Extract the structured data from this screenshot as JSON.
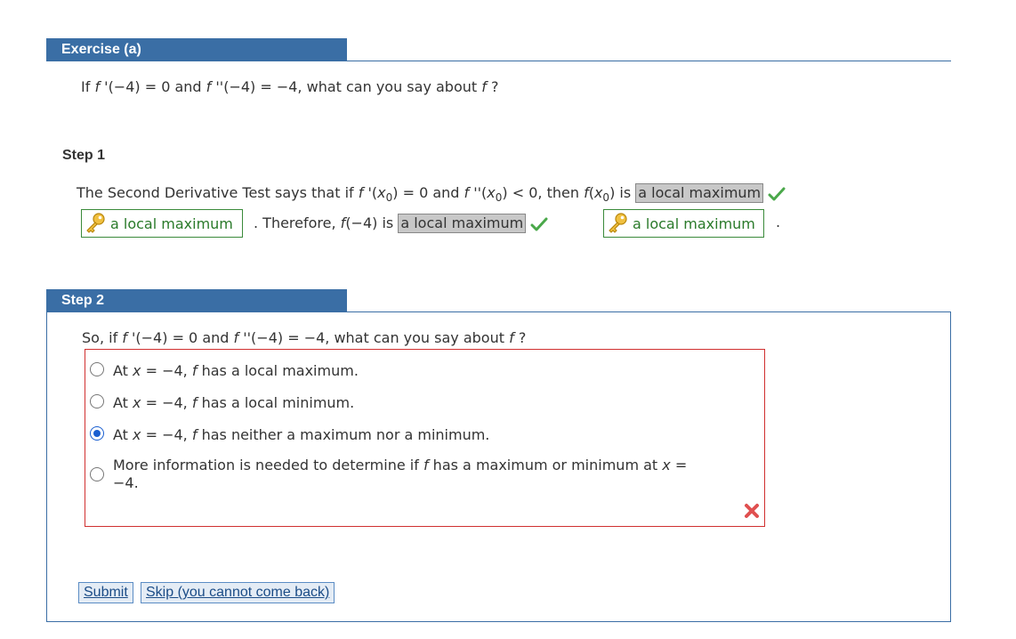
{
  "exercise": {
    "header": "Exercise (a)",
    "question_prefix": "If ",
    "f1": "f",
    "q1": " '(−4) = 0 and ",
    "f2": "f",
    "q2": " ''(−4) = −4,  what can you say about ",
    "f3": "f",
    "q3": " ?"
  },
  "step1": {
    "title": "Step 1",
    "line1_prefix": "The Second Derivative Test says that if ",
    "f_a": "f",
    "line1_mid1": " '(",
    "x0a": "x",
    "sub0a": "0",
    "line1_mid2": ") = 0  and  ",
    "f_b": "f",
    "line1_mid3": " ''(",
    "x0b": "x",
    "sub0b": "0",
    "line1_mid4": ") < 0,  then  ",
    "f_c": "f",
    "line1_mid5": "(",
    "x0c": "x",
    "sub0c": "0",
    "line1_mid6": ")  is ",
    "answer1": "a local maximum",
    "key_answer1": "a local maximum",
    "line2_prefix": ". Therefore,  ",
    "f_d": "f",
    "line2_mid": "(−4)  is ",
    "answer2": "a local maximum",
    "key_answer2": "a local maximum",
    "line2_end": "."
  },
  "step2": {
    "title": "Step 2",
    "question_prefix": "So, if ",
    "f1": "f",
    "q1": " '(−4) = 0 and ",
    "f2": "f",
    "q2": " ''(−4) = −4,  what can you say about ",
    "f3": "f",
    "q3": " ?",
    "options": [
      {
        "pre": "At ",
        "x": "x",
        "mid": " = −4, ",
        "f": "f",
        "post": " has a local maximum."
      },
      {
        "pre": "At ",
        "x": "x",
        "mid": " = −4, ",
        "f": "f",
        "post": " has a local minimum."
      },
      {
        "pre": "At ",
        "x": "x",
        "mid": " = −4, ",
        "f": "f",
        "post": " has neither a maximum nor a minimum."
      },
      {
        "pre": "More information is needed to determine if ",
        "f": "f",
        "mid": " has a maximum or minimum at ",
        "x": "x",
        "post": " =",
        "line2": "−4."
      }
    ],
    "selected_option": 3
  },
  "buttons": {
    "submit": "Submit",
    "skip": "Skip (you cannot come back)"
  },
  "colors": {
    "header_blue": "#3a6ea5",
    "correct_green": "#2a7a2a",
    "wrong_red": "#d03030"
  }
}
